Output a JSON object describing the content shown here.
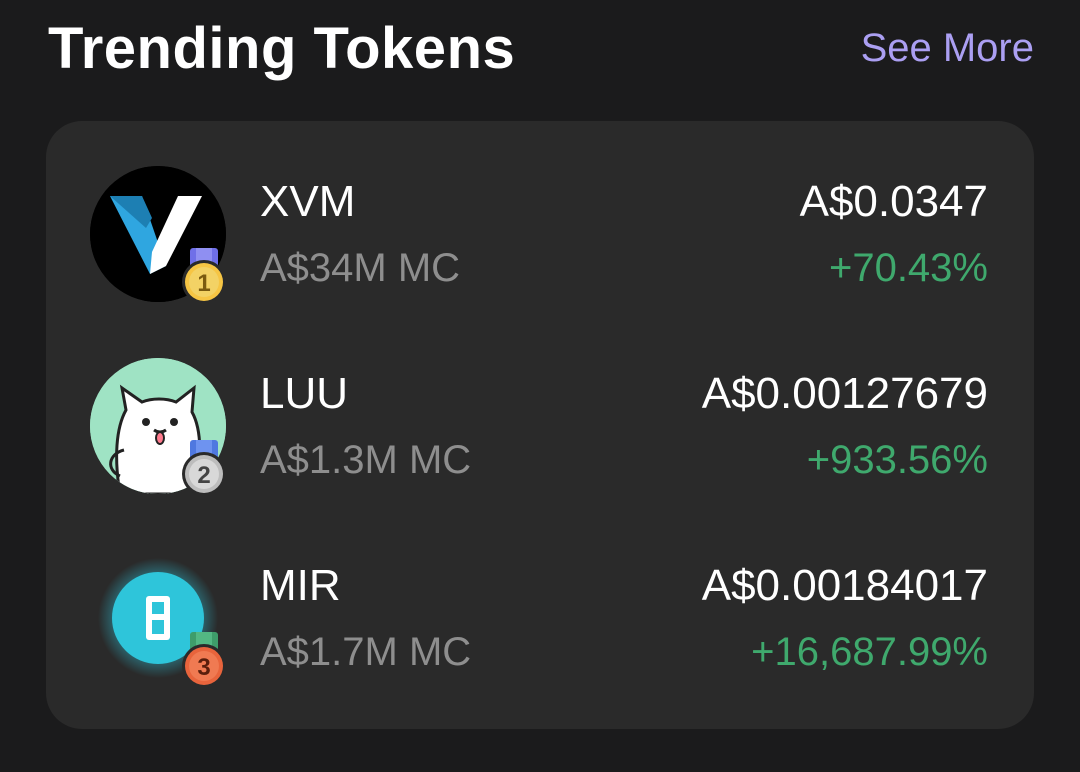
{
  "header": {
    "title": "Trending Tokens",
    "see_more_label": "See More"
  },
  "colors": {
    "background": "#1b1b1c",
    "card": "#2a2a2a",
    "accent": "#ab9ff2",
    "positive": "#3fa96d",
    "muted": "#8e8e8e"
  },
  "tokens": [
    {
      "rank": "1",
      "symbol": "XVM",
      "market_cap": "A$34M MC",
      "price": "A$0.0347",
      "change": "+70.43%",
      "icon": "xvm-logo-icon",
      "medal": "gold-medal-icon"
    },
    {
      "rank": "2",
      "symbol": "LUU",
      "market_cap": "A$1.3M MC",
      "price": "A$0.00127679",
      "change": "+933.56%",
      "icon": "luu-cat-logo-icon",
      "medal": "silver-medal-icon"
    },
    {
      "rank": "3",
      "symbol": "MIR",
      "market_cap": "A$1.7M MC",
      "price": "A$0.00184017",
      "change": "+16,687.99%",
      "icon": "mir-logo-icon",
      "medal": "bronze-medal-icon"
    }
  ]
}
